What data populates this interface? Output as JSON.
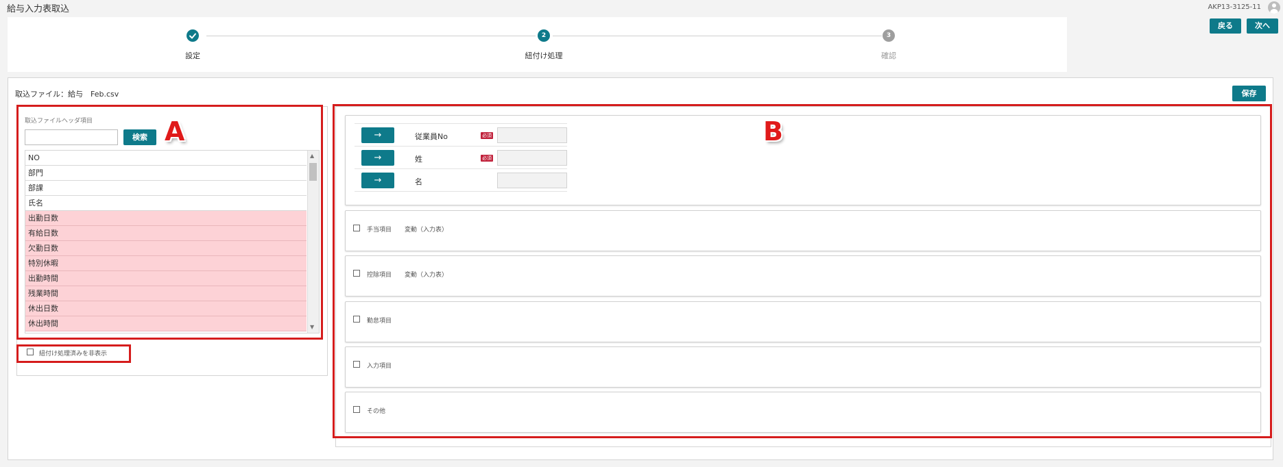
{
  "app": {
    "title": "給与入力表取込",
    "user_id": "AKP13-3125-11"
  },
  "header_buttons": {
    "back": "戻る",
    "next": "次へ"
  },
  "steps": [
    {
      "number": "✓",
      "label": "設定",
      "state": "done"
    },
    {
      "number": "2",
      "label": "紐付け処理",
      "state": "active"
    },
    {
      "number": "3",
      "label": "確認",
      "state": "pending"
    }
  ],
  "file": {
    "label": "取込ファイル：給与　Feb.csv"
  },
  "save_button": "保存",
  "left_panel": {
    "header_label": "取込ファイルヘッダ項目",
    "search": {
      "value": "",
      "placeholder": "",
      "button": "検索"
    },
    "items": [
      "NO",
      "部門",
      "部課",
      "氏名",
      "出勤日数",
      "有給日数",
      "欠勤日数",
      "特別休暇",
      "出勤時間",
      "残業時間",
      "休出日数",
      "休出時間"
    ],
    "hide_processed_label": "紐付け処理済みを非表示"
  },
  "mapping_rows": [
    {
      "arrow": "→",
      "label": "従業員No",
      "required": "必須"
    },
    {
      "arrow": "→",
      "label": "姓",
      "required": "必須"
    },
    {
      "arrow": "→",
      "label": "名",
      "required": ""
    }
  ],
  "sections": [
    {
      "label": "手当項目",
      "sub": "変動（入力表）"
    },
    {
      "label": "控除項目",
      "sub": "変動（入力表）"
    },
    {
      "label": "勤怠項目",
      "sub": ""
    },
    {
      "label": "入力項目",
      "sub": ""
    },
    {
      "label": "その他",
      "sub": ""
    }
  ],
  "annotations": {
    "a": "A",
    "b": "B"
  },
  "colors": {
    "accent": "#0e7a8a",
    "highlight": "#fdd2d6",
    "annotation": "#d51c1c",
    "required": "#c0203a"
  },
  "icons": {
    "step_done": "check-icon",
    "arrow": "right-arrow-icon",
    "user": "user-avatar-icon"
  }
}
